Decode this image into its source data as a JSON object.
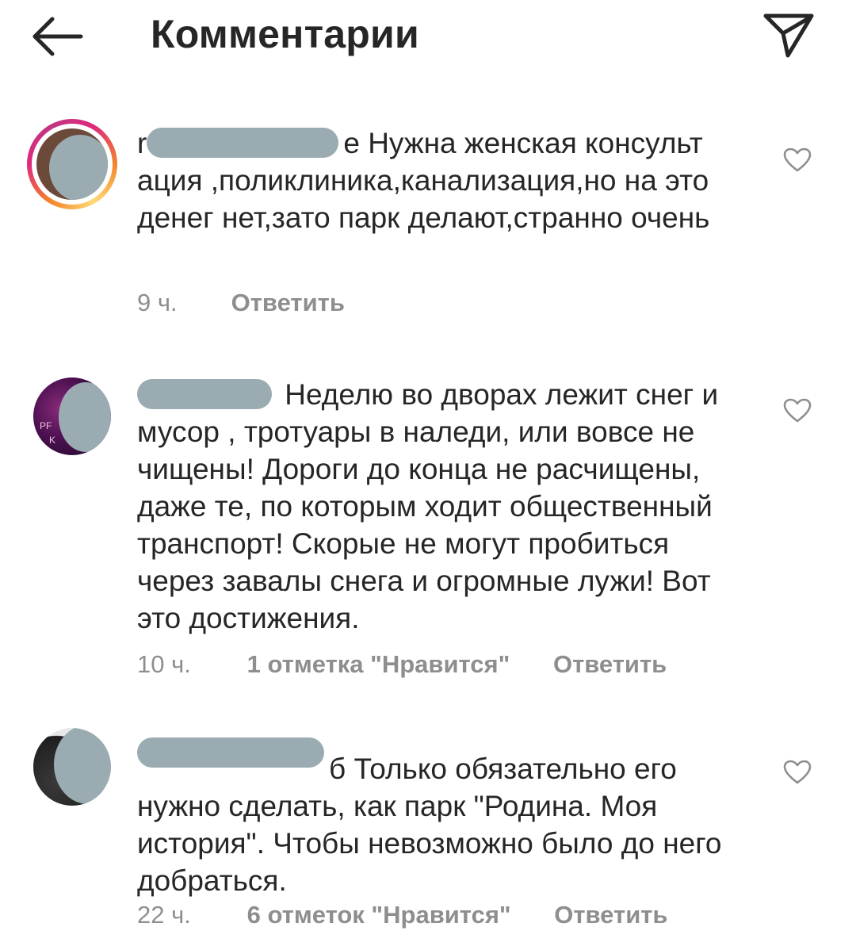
{
  "header": {
    "title": "Комментарии",
    "back_icon": "arrow-left-icon",
    "send_icon": "paper-plane-icon"
  },
  "comments": [
    {
      "username_visible_fragment_start": "r",
      "username_visible_fragment_end": "e",
      "text_line1": "Нужна женская консульт",
      "text_rest": "ация ,поликлиника,канализация,но на это денег нет,зато парк делают,странно очень",
      "time": "9 ч.",
      "likes": "",
      "reply": "Ответить",
      "avatar_style": "story-ring"
    },
    {
      "username_visible_fragment_start": "",
      "username_visible_fragment_end": "",
      "text_line1": "Неделю во дворах лежит",
      "text_rest": "снег и мусор , тротуары в наледи, или вовсе не чищены! Дороги до конца не расчищены, даже те, по которым ходит общественный транспорт! Скорые не могут пробиться через завалы снега и огромные лужи!  Вот это достижения.",
      "time": "10 ч.",
      "likes": "1 отметка \"Нравится\"",
      "reply": "Ответить",
      "avatar_style": "dark-purple",
      "avatar_text_a": "PF",
      "avatar_text_b": "K"
    },
    {
      "username_visible_fragment_start": "",
      "username_visible_fragment_end": "б",
      "text_line1": "Только обязательно его",
      "text_rest": "нужно сделать, как парк \"Родина. Моя история\". Чтобы невозможно было до него добраться.",
      "time": "22 ч.",
      "likes": "6 отметок \"Нравится\"",
      "reply": "Ответить",
      "avatar_style": "dark-photo"
    }
  ],
  "colors": {
    "text_primary": "#262626",
    "text_secondary": "#8e8e8e",
    "mask_gray": "#9aacb2",
    "story_ring_a": "#f58529",
    "story_ring_b": "#dd2a7b"
  }
}
